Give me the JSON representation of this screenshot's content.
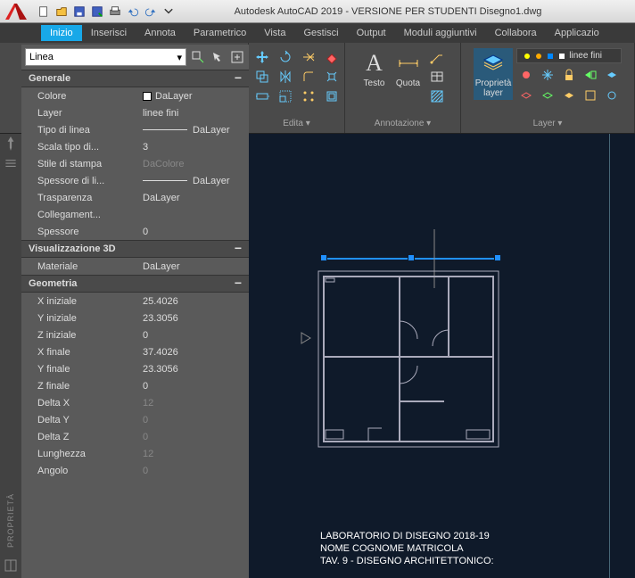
{
  "title": "Autodesk AutoCAD 2019 - VERSIONE PER STUDENTI   Disegno1.dwg",
  "menu": [
    "Inizio",
    "Inserisci",
    "Annota",
    "Parametrico",
    "Vista",
    "Gestisci",
    "Output",
    "Moduli aggiuntivi",
    "Collabora",
    "Applicazio"
  ],
  "active_menu": 0,
  "ribbon": {
    "selection_type": "Linea",
    "group_edit": "Edita ▾",
    "group_anno": "Annotazione ▾",
    "group_layer": "Layer ▾",
    "btn_testo": "Testo",
    "btn_quota": "Quota",
    "btn_proplayer": "Proprietà\nlayer",
    "layer_current": "linee fini"
  },
  "props": {
    "selector": "Linea",
    "sections": {
      "generale": "Generale",
      "vis3d": "Visualizzazione 3D",
      "geometria": "Geometria"
    },
    "labels": {
      "colore": "Colore",
      "layer": "Layer",
      "tipolinea": "Tipo di linea",
      "scalatl": "Scala tipo di...",
      "stilestampa": "Stile di stampa",
      "spessli": "Spessore di li...",
      "trasparenza": "Trasparenza",
      "colleg": "Collegament...",
      "spessore": "Spessore",
      "materiale": "Materiale",
      "xiniz": "X iniziale",
      "yiniz": "Y iniziale",
      "ziniz": "Z iniziale",
      "xfin": "X finale",
      "yfin": "Y finale",
      "zfin": "Z finale",
      "dx": "Delta X",
      "dy": "Delta Y",
      "dz": "Delta Z",
      "lung": "Lunghezza",
      "angolo": "Angolo"
    },
    "values": {
      "colore": "DaLayer",
      "layer": "linee fini",
      "tipolinea": "DaLayer",
      "scalatl": "3",
      "stilestampa": "DaColore",
      "spessli": "DaLayer",
      "trasparenza": "DaLayer",
      "colleg": "",
      "spessore": "0",
      "materiale": "DaLayer",
      "xiniz": "25.4026",
      "yiniz": "23.3056",
      "ziniz": "0",
      "xfin": "37.4026",
      "yfin": "23.3056",
      "zfin": "0",
      "dx": "12",
      "dy": "0",
      "dz": "0",
      "lung": "12",
      "angolo": "0"
    }
  },
  "sidebar_label": "PROPRIETÀ",
  "drawing_text": {
    "l1": "LABORATORIO DI DISEGNO 2018-19",
    "l2": "NOME COGNOME MATRICOLA",
    "l3": "TAV. 9 - DISEGNO ARCHITETTONICO:"
  }
}
